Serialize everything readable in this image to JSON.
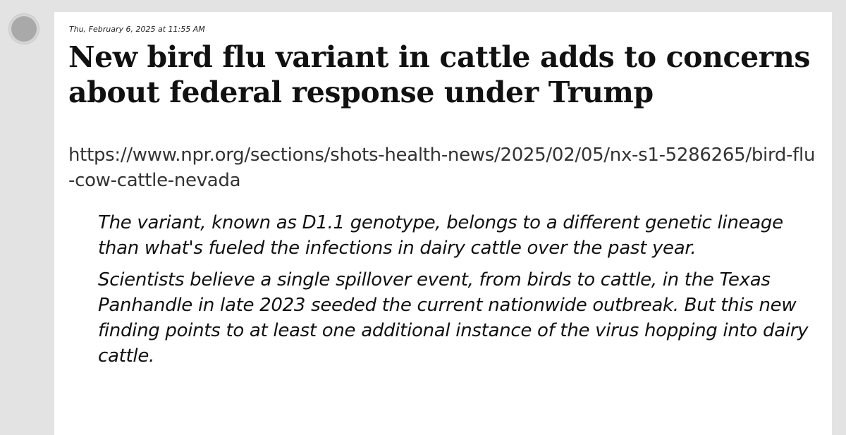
{
  "post": {
    "timestamp": "Thu, February 6, 2025 at 11:55 AM",
    "title": "New bird flu variant in cattle adds to concerns about federal response under Trump",
    "url": "https://www.npr.org/sections/shots-health-news/2025/02/05/nx-s1-5286265/bird-flu-cow-cattle-nevada",
    "quote_paragraphs": [
      "The variant, known as D1.1 genotype, belongs to a different genetic lineage than what's fueled the infections in dairy cattle over the past year.",
      "Scientists believe a single spillover event, from birds to cattle, in the Texas Panhandle in late 2023 seeded the current nationwide outbreak. But this new finding points to at least one additional instance of the virus hopping into dairy cattle."
    ]
  },
  "colors": {
    "page_background": "#e3e3e3",
    "card_background": "#ffffff",
    "avatar": "#a9a9a9"
  }
}
